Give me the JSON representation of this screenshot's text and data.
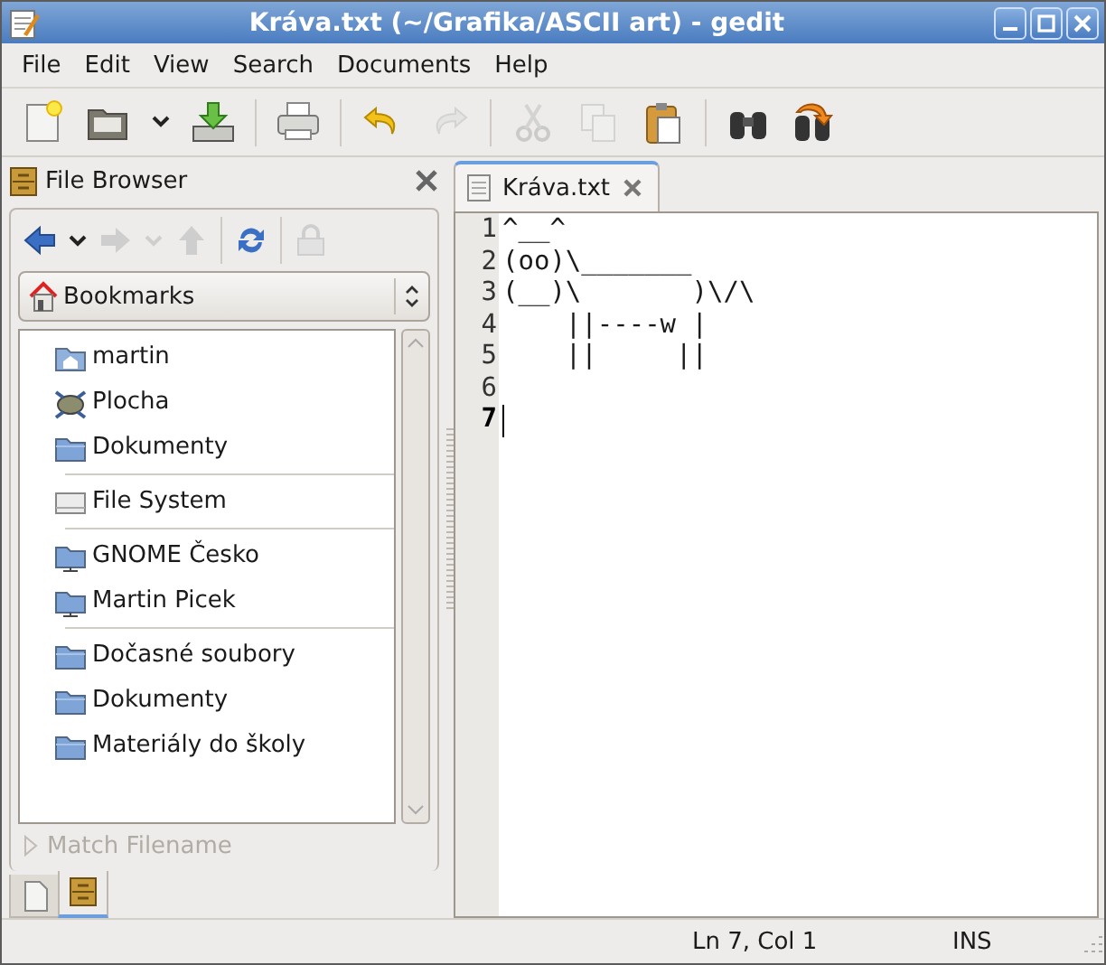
{
  "window": {
    "title": "Kráva.txt (~/Grafika/ASCII art) - gedit"
  },
  "menu": [
    "File",
    "Edit",
    "View",
    "Search",
    "Documents",
    "Help"
  ],
  "toolbar": [
    {
      "kind": "button",
      "disabled": false
    },
    {
      "kind": "button",
      "disabled": false
    },
    {
      "kind": "dropdown",
      "disabled": false
    },
    {
      "kind": "button",
      "disabled": false
    },
    {
      "kind": "separator"
    },
    {
      "kind": "button",
      "disabled": false
    },
    {
      "kind": "separator"
    },
    {
      "kind": "button",
      "disabled": false
    },
    {
      "kind": "button",
      "disabled": true
    },
    {
      "kind": "separator"
    },
    {
      "kind": "button",
      "disabled": true
    },
    {
      "kind": "button",
      "disabled": true
    },
    {
      "kind": "button",
      "disabled": false
    },
    {
      "kind": "separator"
    },
    {
      "kind": "button",
      "disabled": false
    },
    {
      "kind": "button",
      "disabled": false
    }
  ],
  "side_panel": {
    "title": "File Browser",
    "nav": [
      {
        "kind": "button",
        "disabled": false
      },
      {
        "kind": "dropdown",
        "disabled": false
      },
      {
        "kind": "button",
        "disabled": true
      },
      {
        "kind": "dropdown",
        "disabled": true
      },
      {
        "kind": "button",
        "disabled": true
      },
      {
        "kind": "separator"
      },
      {
        "kind": "button",
        "disabled": false
      },
      {
        "kind": "separator"
      },
      {
        "kind": "button",
        "disabled": true
      }
    ],
    "location": "Bookmarks",
    "groups": [
      [
        {
          "label": "martin",
          "kind": "home"
        },
        {
          "label": "Plocha",
          "kind": "desktop"
        },
        {
          "label": "Dokumenty",
          "kind": "folder"
        }
      ],
      [
        {
          "label": "File System",
          "kind": "drive"
        }
      ],
      [
        {
          "label": "GNOME Česko",
          "kind": "network"
        },
        {
          "label": "Martin Picek",
          "kind": "network"
        }
      ],
      [
        {
          "label": "Dočasné soubory",
          "kind": "folder"
        },
        {
          "label": "Dokumenty",
          "kind": "folder"
        },
        {
          "label": "Materiály do školy",
          "kind": "folder"
        }
      ]
    ],
    "filter": {
      "label": "Match Filename",
      "disabled": true
    },
    "tabs": [
      {
        "kind": "documents",
        "selected": false
      },
      {
        "kind": "browser",
        "selected": true
      }
    ]
  },
  "editor": {
    "tabs": [
      {
        "label": "Kráva.txt",
        "selected": true
      }
    ],
    "lines": [
      {
        "number": "1",
        "text": "^__^",
        "current": false
      },
      {
        "number": "2",
        "text": "(oo)\\_______",
        "current": false
      },
      {
        "number": "3",
        "text": "(__)\\       )\\/\\",
        "current": false
      },
      {
        "number": "4",
        "text": "    ||----w |",
        "current": false
      },
      {
        "number": "5",
        "text": "    ||     ||",
        "current": false
      },
      {
        "number": "6",
        "current": false
      },
      {
        "number": "7",
        "current": true
      }
    ]
  },
  "status_bar": {
    "position": "Ln 7, Col 1",
    "mode": "INS"
  }
}
